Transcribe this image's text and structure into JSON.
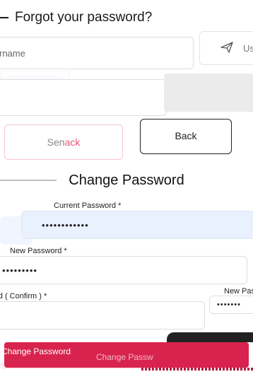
{
  "header": {
    "title": "Forgot your password?"
  },
  "forgot": {
    "username_placeholder": "rname",
    "send_side_label": "Us",
    "send_button": {
      "left": "Sen",
      "right": "ack"
    },
    "back_button": "Back"
  },
  "change": {
    "title": "Change Password",
    "current_label": "Current Password *",
    "current_value": "••••••••••••",
    "new_label": "New Password *",
    "new_value": "•••••••••",
    "confirm_label": "ord ( Confirm ) *",
    "new2_label": "New Pass",
    "new2_value": "•••••••",
    "button_label_left": "Change Password",
    "button_label_mid": "Change Passw"
  },
  "colors": {
    "accent": "#d8234e",
    "input_filled": "#eaf1fe"
  }
}
